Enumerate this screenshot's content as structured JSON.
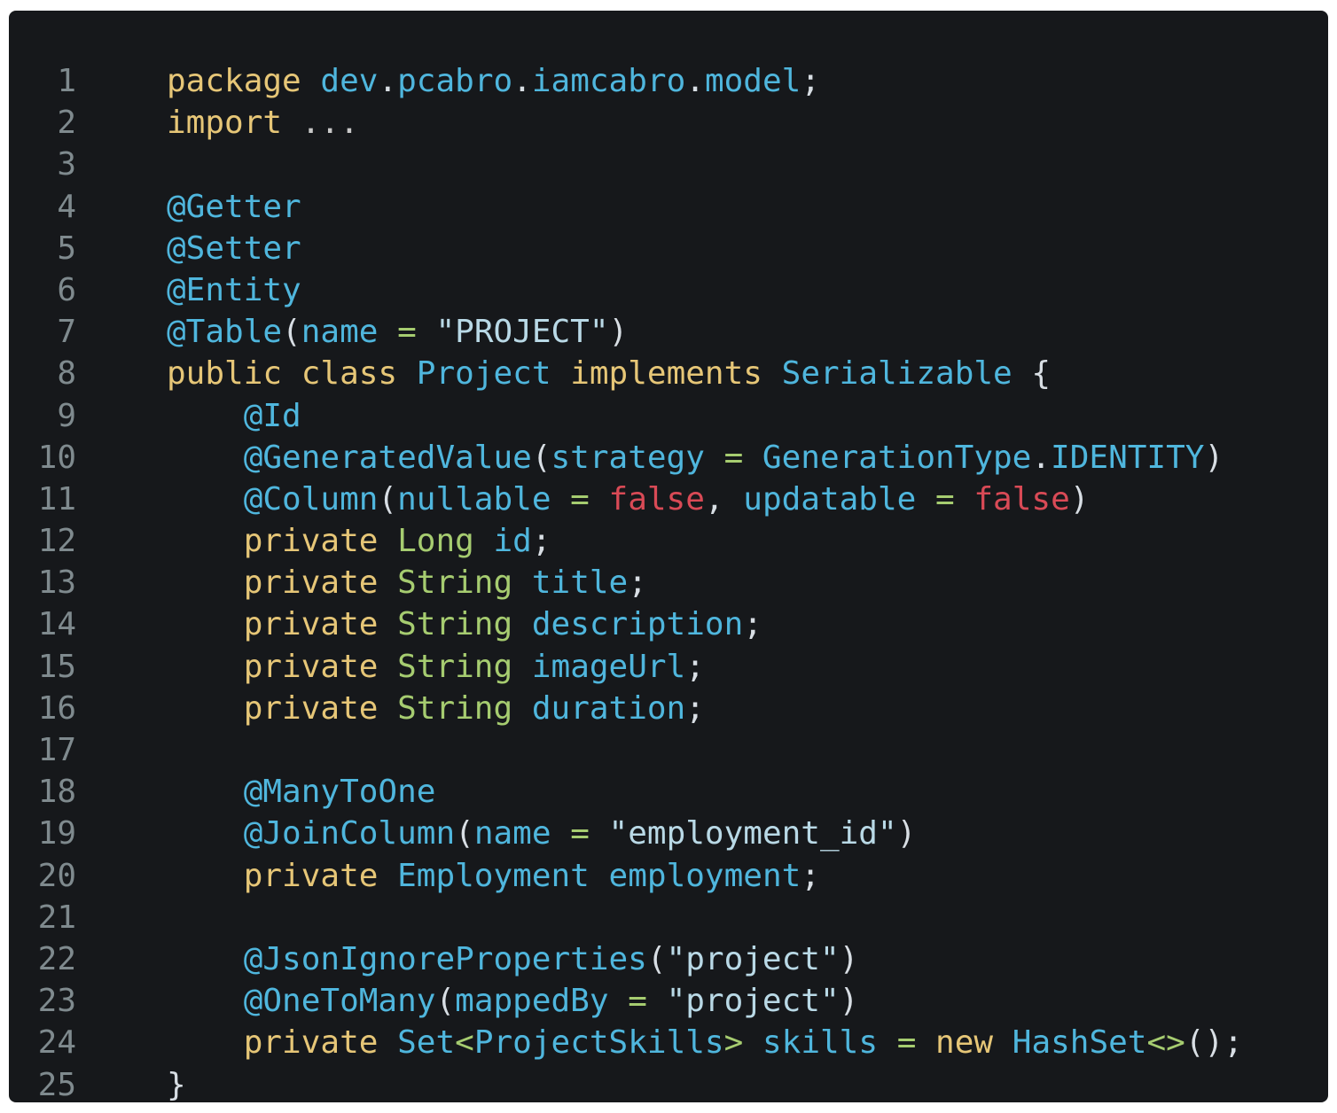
{
  "editor": {
    "lines": [
      {
        "number": "1",
        "indent": "",
        "tokens": [
          {
            "text": "package",
            "kind": "kw"
          },
          {
            "text": " ",
            "kind": "punc"
          },
          {
            "text": "dev",
            "kind": "id"
          },
          {
            "text": ".",
            "kind": "punc"
          },
          {
            "text": "pcabro",
            "kind": "id"
          },
          {
            "text": ".",
            "kind": "punc"
          },
          {
            "text": "iamcabro",
            "kind": "id"
          },
          {
            "text": ".",
            "kind": "punc"
          },
          {
            "text": "model",
            "kind": "id"
          },
          {
            "text": ";",
            "kind": "punc"
          }
        ]
      },
      {
        "number": "2",
        "indent": "",
        "tokens": [
          {
            "text": "import",
            "kind": "kw"
          },
          {
            "text": " ...",
            "kind": "dim"
          }
        ]
      },
      {
        "number": "3",
        "indent": "",
        "tokens": []
      },
      {
        "number": "4",
        "indent": "",
        "tokens": [
          {
            "text": "@Getter",
            "kind": "id"
          }
        ]
      },
      {
        "number": "5",
        "indent": "",
        "tokens": [
          {
            "text": "@Setter",
            "kind": "id"
          }
        ]
      },
      {
        "number": "6",
        "indent": "",
        "tokens": [
          {
            "text": "@Entity",
            "kind": "id"
          }
        ]
      },
      {
        "number": "7",
        "indent": "",
        "tokens": [
          {
            "text": "@Table",
            "kind": "id"
          },
          {
            "text": "(",
            "kind": "punc"
          },
          {
            "text": "name",
            "kind": "id"
          },
          {
            "text": " = ",
            "kind": "op"
          },
          {
            "text": "\"PROJECT\"",
            "kind": "str"
          },
          {
            "text": ")",
            "kind": "punc"
          }
        ]
      },
      {
        "number": "8",
        "indent": "",
        "tokens": [
          {
            "text": "public",
            "kind": "kw"
          },
          {
            "text": " ",
            "kind": "punc"
          },
          {
            "text": "class",
            "kind": "kw"
          },
          {
            "text": " ",
            "kind": "punc"
          },
          {
            "text": "Project",
            "kind": "id"
          },
          {
            "text": " ",
            "kind": "punc"
          },
          {
            "text": "implements",
            "kind": "kw"
          },
          {
            "text": " ",
            "kind": "punc"
          },
          {
            "text": "Serializable",
            "kind": "id"
          },
          {
            "text": " {",
            "kind": "punc"
          }
        ]
      },
      {
        "number": "9",
        "indent": "    ",
        "tokens": [
          {
            "text": "@Id",
            "kind": "id"
          }
        ]
      },
      {
        "number": "10",
        "indent": "    ",
        "tokens": [
          {
            "text": "@GeneratedValue",
            "kind": "id"
          },
          {
            "text": "(",
            "kind": "punc"
          },
          {
            "text": "strategy",
            "kind": "id"
          },
          {
            "text": " = ",
            "kind": "op"
          },
          {
            "text": "GenerationType",
            "kind": "id"
          },
          {
            "text": ".",
            "kind": "punc"
          },
          {
            "text": "IDENTITY",
            "kind": "id"
          },
          {
            "text": ")",
            "kind": "punc"
          }
        ]
      },
      {
        "number": "11",
        "indent": "    ",
        "tokens": [
          {
            "text": "@Column",
            "kind": "id"
          },
          {
            "text": "(",
            "kind": "punc"
          },
          {
            "text": "nullable",
            "kind": "id"
          },
          {
            "text": " = ",
            "kind": "op"
          },
          {
            "text": "false",
            "kind": "bool"
          },
          {
            "text": ", ",
            "kind": "punc"
          },
          {
            "text": "updatable",
            "kind": "id"
          },
          {
            "text": " = ",
            "kind": "op"
          },
          {
            "text": "false",
            "kind": "bool"
          },
          {
            "text": ")",
            "kind": "punc"
          }
        ]
      },
      {
        "number": "12",
        "indent": "    ",
        "tokens": [
          {
            "text": "private",
            "kind": "kw"
          },
          {
            "text": " ",
            "kind": "punc"
          },
          {
            "text": "Long",
            "kind": "type"
          },
          {
            "text": " ",
            "kind": "punc"
          },
          {
            "text": "id",
            "kind": "id"
          },
          {
            "text": ";",
            "kind": "punc"
          }
        ]
      },
      {
        "number": "13",
        "indent": "    ",
        "tokens": [
          {
            "text": "private",
            "kind": "kw"
          },
          {
            "text": " ",
            "kind": "punc"
          },
          {
            "text": "String",
            "kind": "type"
          },
          {
            "text": " ",
            "kind": "punc"
          },
          {
            "text": "title",
            "kind": "id"
          },
          {
            "text": ";",
            "kind": "punc"
          }
        ]
      },
      {
        "number": "14",
        "indent": "    ",
        "tokens": [
          {
            "text": "private",
            "kind": "kw"
          },
          {
            "text": " ",
            "kind": "punc"
          },
          {
            "text": "String",
            "kind": "type"
          },
          {
            "text": " ",
            "kind": "punc"
          },
          {
            "text": "description",
            "kind": "id"
          },
          {
            "text": ";",
            "kind": "punc"
          }
        ]
      },
      {
        "number": "15",
        "indent": "    ",
        "tokens": [
          {
            "text": "private",
            "kind": "kw"
          },
          {
            "text": " ",
            "kind": "punc"
          },
          {
            "text": "String",
            "kind": "type"
          },
          {
            "text": " ",
            "kind": "punc"
          },
          {
            "text": "imageUrl",
            "kind": "id"
          },
          {
            "text": ";",
            "kind": "punc"
          }
        ]
      },
      {
        "number": "16",
        "indent": "    ",
        "tokens": [
          {
            "text": "private",
            "kind": "kw"
          },
          {
            "text": " ",
            "kind": "punc"
          },
          {
            "text": "String",
            "kind": "type"
          },
          {
            "text": " ",
            "kind": "punc"
          },
          {
            "text": "duration",
            "kind": "id"
          },
          {
            "text": ";",
            "kind": "punc"
          }
        ]
      },
      {
        "number": "17",
        "indent": "",
        "tokens": []
      },
      {
        "number": "18",
        "indent": "    ",
        "tokens": [
          {
            "text": "@ManyToOne",
            "kind": "id"
          }
        ]
      },
      {
        "number": "19",
        "indent": "    ",
        "tokens": [
          {
            "text": "@JoinColumn",
            "kind": "id"
          },
          {
            "text": "(",
            "kind": "punc"
          },
          {
            "text": "name",
            "kind": "id"
          },
          {
            "text": " = ",
            "kind": "op"
          },
          {
            "text": "\"employment_id\"",
            "kind": "str"
          },
          {
            "text": ")",
            "kind": "punc"
          }
        ]
      },
      {
        "number": "20",
        "indent": "    ",
        "tokens": [
          {
            "text": "private",
            "kind": "kw"
          },
          {
            "text": " ",
            "kind": "punc"
          },
          {
            "text": "Employment",
            "kind": "id"
          },
          {
            "text": " ",
            "kind": "punc"
          },
          {
            "text": "employment",
            "kind": "id"
          },
          {
            "text": ";",
            "kind": "punc"
          }
        ]
      },
      {
        "number": "21",
        "indent": "",
        "tokens": []
      },
      {
        "number": "22",
        "indent": "    ",
        "tokens": [
          {
            "text": "@JsonIgnoreProperties",
            "kind": "id"
          },
          {
            "text": "(",
            "kind": "punc"
          },
          {
            "text": "\"project\"",
            "kind": "str"
          },
          {
            "text": ")",
            "kind": "punc"
          }
        ]
      },
      {
        "number": "23",
        "indent": "    ",
        "tokens": [
          {
            "text": "@OneToMany",
            "kind": "id"
          },
          {
            "text": "(",
            "kind": "punc"
          },
          {
            "text": "mappedBy",
            "kind": "id"
          },
          {
            "text": " = ",
            "kind": "op"
          },
          {
            "text": "\"project\"",
            "kind": "str"
          },
          {
            "text": ")",
            "kind": "punc"
          }
        ]
      },
      {
        "number": "24",
        "indent": "    ",
        "tokens": [
          {
            "text": "private",
            "kind": "kw"
          },
          {
            "text": " ",
            "kind": "punc"
          },
          {
            "text": "Set",
            "kind": "id"
          },
          {
            "text": "<",
            "kind": "op"
          },
          {
            "text": "ProjectSkills",
            "kind": "id"
          },
          {
            "text": ">",
            "kind": "op"
          },
          {
            "text": " ",
            "kind": "punc"
          },
          {
            "text": "skills",
            "kind": "id"
          },
          {
            "text": " = ",
            "kind": "op"
          },
          {
            "text": "new",
            "kind": "kw"
          },
          {
            "text": " ",
            "kind": "punc"
          },
          {
            "text": "HashSet",
            "kind": "id"
          },
          {
            "text": "<>",
            "kind": "op"
          },
          {
            "text": "();",
            "kind": "punc"
          }
        ]
      },
      {
        "number": "25",
        "indent": "",
        "tokens": [
          {
            "text": "}",
            "kind": "punc"
          }
        ]
      }
    ]
  }
}
